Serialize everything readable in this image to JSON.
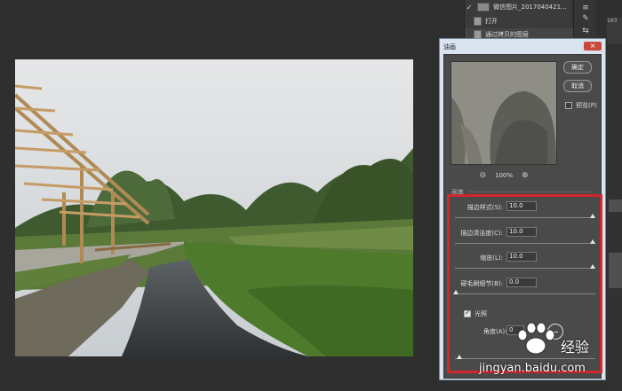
{
  "history": {
    "snapshot_label": "微信图片_2017040421...",
    "items": [
      {
        "label": "打开"
      },
      {
        "label": "通过拷贝的图层"
      }
    ]
  },
  "right_stub": {
    "text": "163"
  },
  "dialog": {
    "title": "油画",
    "close_label": "×",
    "ok_label": "确定",
    "cancel_label": "取消",
    "preview_label": "预览(P)",
    "zoom": "100%",
    "section_label": "画笔",
    "params": [
      {
        "label": "描边样式(S):",
        "value": "10.0",
        "level": 1.0
      },
      {
        "label": "描边清洁度(C):",
        "value": "10.0",
        "level": 1.0
      },
      {
        "label": "缩放(L):",
        "value": "10.0",
        "level": 1.0
      },
      {
        "label": "硬毛刷细节(B):",
        "value": "0.0",
        "level": 0.0
      }
    ],
    "lighting": {
      "label": "光照",
      "checked": true
    },
    "angle": {
      "label": "角度(A):",
      "value": "0"
    }
  },
  "watermark": {
    "brand": "经验",
    "url": "jingyan.baidu.com"
  },
  "colors": {
    "highlight": "#d2272b",
    "dialog_frame": "#d9e4f0"
  }
}
